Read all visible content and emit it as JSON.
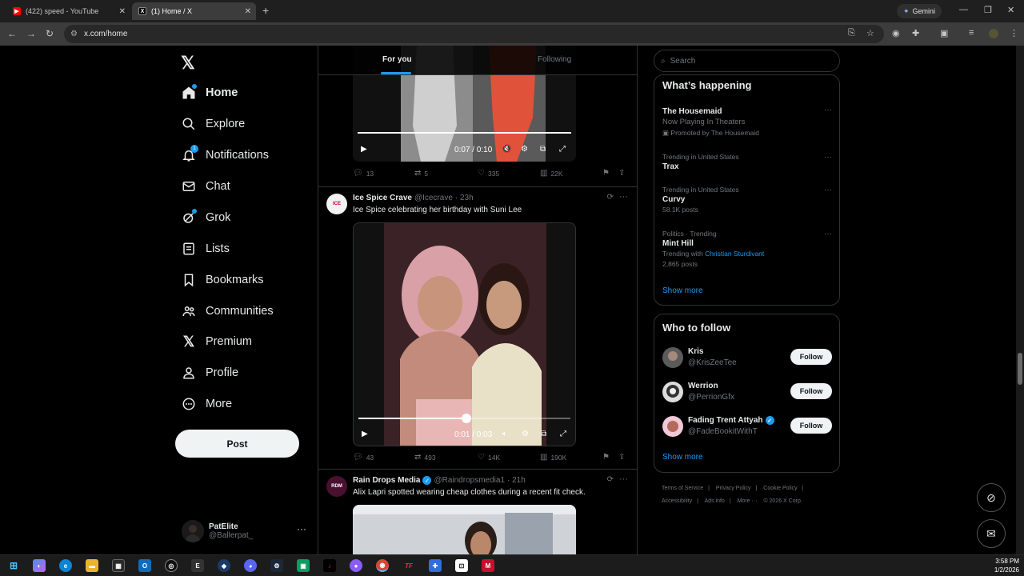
{
  "browser": {
    "tabs": [
      {
        "title": "(422) speed - YouTube",
        "active": false
      },
      {
        "title": "(1) Home / X",
        "active": true
      }
    ],
    "gemini_label": "Gemini",
    "url": "x.com/home"
  },
  "nav": {
    "items": [
      {
        "label": "Home",
        "icon": "home-icon"
      },
      {
        "label": "Explore",
        "icon": "search-icon"
      },
      {
        "label": "Notifications",
        "icon": "bell-icon",
        "badge": "1"
      },
      {
        "label": "Chat",
        "icon": "mail-icon"
      },
      {
        "label": "Grok",
        "icon": "grok-icon"
      },
      {
        "label": "Lists",
        "icon": "list-icon"
      },
      {
        "label": "Bookmarks",
        "icon": "bookmark-icon"
      },
      {
        "label": "Communities",
        "icon": "people-icon"
      },
      {
        "label": "Premium",
        "icon": "x-logo-icon"
      },
      {
        "label": "Profile",
        "icon": "person-icon"
      },
      {
        "label": "More",
        "icon": "more-circle-icon"
      }
    ],
    "post_label": "Post",
    "account": {
      "name": "PatElite",
      "handle": "@Ballerpat_"
    }
  },
  "feed": {
    "tabs": {
      "for_you": "For you",
      "following": "Following"
    },
    "video1": {
      "time": "0:07 / 0:10",
      "progress": 1.0
    },
    "actions1": {
      "replies": "13",
      "reposts": "5",
      "likes": "335",
      "views": "22K"
    },
    "post2": {
      "name": "Ice Spice Crave",
      "handle": "@Icecrave",
      "time": "· 23h",
      "text": "Ice Spice celebrating her birthday with Suni Lee",
      "avatar_text": "ICE",
      "video_time": "0:01 / 0:03",
      "video_progress": 0.51,
      "replies": "43",
      "reposts": "493",
      "likes": "14K",
      "views": "190K"
    },
    "post3": {
      "name": "Rain Drops Media",
      "handle": "@Raindropsmedia1",
      "time": "· 21h",
      "text": "Alix Lapri spotted wearing cheap clothes during a recent fit check.",
      "avatar_text": "RDM"
    }
  },
  "sidebar": {
    "search_placeholder": "Search",
    "happening": {
      "title": "What’s happening",
      "trends": [
        {
          "meta": "",
          "name": "The Housemaid",
          "sub": "Now Playing In Theaters",
          "promo": "Promoted by The Housemaid"
        },
        {
          "meta": "Trending in United States",
          "name": "Trax",
          "sub": ""
        },
        {
          "meta": "Trending in United States",
          "name": "Curvy",
          "sub": "58.1K posts"
        },
        {
          "meta": "Politics · Trending",
          "name": "Mint Hill",
          "sub_prefix": "Trending with",
          "sub_link": "Christian Sturdivant",
          "sub2": "2,865 posts"
        }
      ],
      "show_more": "Show more"
    },
    "who_to_follow": {
      "title": "Who to follow",
      "users": [
        {
          "name": "Kris",
          "handle": "@KrisZeeTee",
          "verified": false
        },
        {
          "name": "Werrion",
          "handle": "@PerrionGfx",
          "verified": false
        },
        {
          "name": "Fading Trent Attyah",
          "handle": "@FadeBookitWithT",
          "verified": true
        }
      ],
      "follow_label": "Follow",
      "show_more": "Show more"
    },
    "footer": [
      "Terms of Service",
      "|",
      "Privacy Policy",
      "|",
      "Cookie Policy",
      "|",
      "Accessibility",
      "|",
      "Ads info",
      "|",
      "More ···",
      "© 2026 X Corp."
    ]
  },
  "taskbar": {
    "time": "3:58 PM",
    "date": "1/2/2026"
  },
  "colors": {
    "accent": "#1d9bf0",
    "bg": "#000000",
    "border": "#2f3336",
    "muted": "#71767b"
  }
}
